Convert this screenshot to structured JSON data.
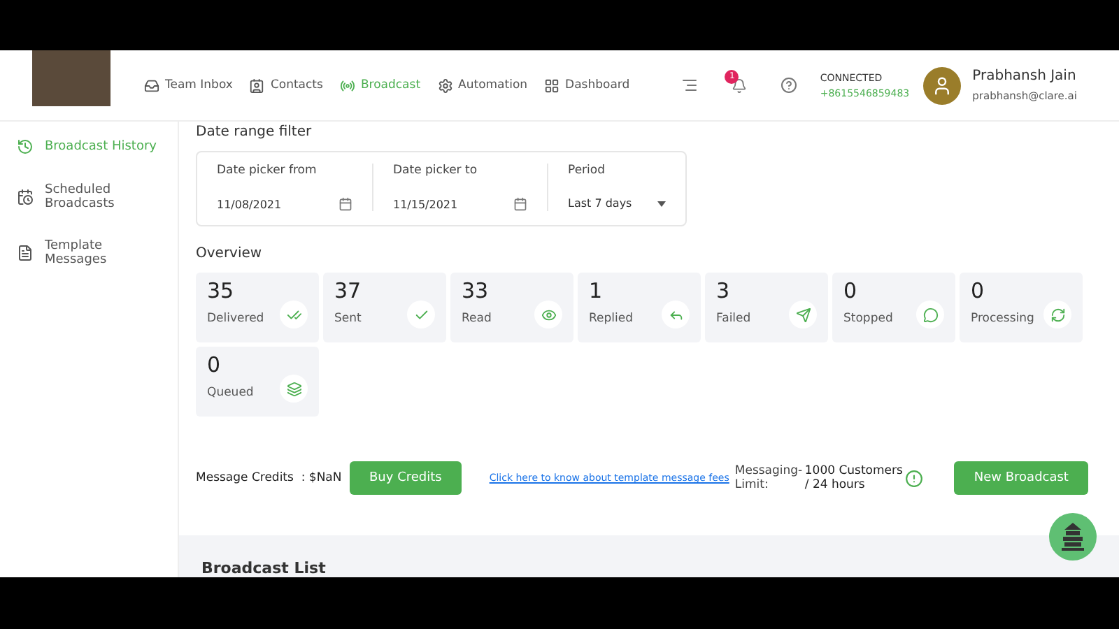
{
  "nav": {
    "items": [
      {
        "label": "Team Inbox",
        "selected": false
      },
      {
        "label": "Contacts",
        "selected": false
      },
      {
        "label": "Broadcast",
        "selected": true
      },
      {
        "label": "Automation",
        "selected": false
      },
      {
        "label": "Dashboard",
        "selected": false
      }
    ],
    "notification_count": "1",
    "status": "CONNECTED",
    "phone": "+8615546859483",
    "user_name": "Prabhansh Jain",
    "user_email": "prabhansh@clare.ai"
  },
  "sidebar": {
    "items": [
      {
        "label": "Broadcast History",
        "selected": true
      },
      {
        "label": "Scheduled Broadcasts",
        "selected": false
      },
      {
        "label": "Template Messages",
        "selected": false
      }
    ]
  },
  "filter": {
    "title": "Date range filter",
    "from_label": "Date picker from",
    "from_value": "11/08/2021",
    "to_label": "Date picker to",
    "to_value": "11/15/2021",
    "period_label": "Period",
    "period_value": "Last 7 days"
  },
  "overview": {
    "title": "Overview",
    "stats": [
      {
        "value": "35",
        "label": "Delivered"
      },
      {
        "value": "37",
        "label": "Sent"
      },
      {
        "value": "33",
        "label": "Read"
      },
      {
        "value": "1",
        "label": "Replied"
      },
      {
        "value": "3",
        "label": "Failed"
      },
      {
        "value": "0",
        "label": "Stopped"
      },
      {
        "value": "0",
        "label": "Processing"
      },
      {
        "value": "0",
        "label": "Queued"
      }
    ]
  },
  "credits": {
    "label": "Message Credits  : $NaN",
    "buy_button": "Buy Credits",
    "fees_link": "Click here to know about template message fees",
    "limit_label": "Messaging-Limit:",
    "limit_value": "1000 Customers / 24 hours",
    "new_button": "New Broadcast"
  },
  "list": {
    "title": "Broadcast List"
  }
}
